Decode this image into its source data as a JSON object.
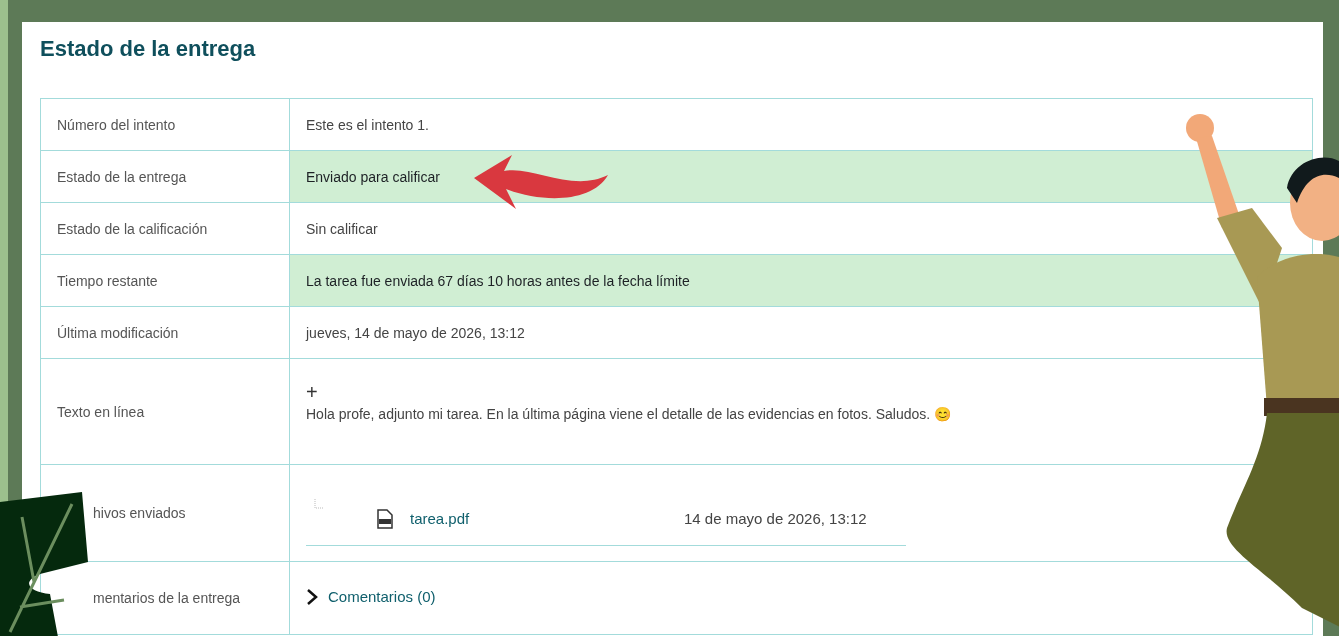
{
  "title": "Estado de la entrega",
  "rows": [
    {
      "label": "Número del intento",
      "kind": "text",
      "value": "Este es el intento 1.",
      "highlighted": false,
      "partly_hidden": false
    },
    {
      "label": "Estado de la entrega",
      "kind": "text",
      "value": "Enviado para calificar",
      "highlighted": true,
      "partly_hidden": false
    },
    {
      "label": "Estado de la calificación",
      "kind": "text",
      "value": "Sin calificar",
      "highlighted": false,
      "partly_hidden": false
    },
    {
      "label": "Tiempo restante",
      "kind": "text",
      "value": "La tarea fue enviada 67 días 10 horas antes de la fecha límite",
      "highlighted": true,
      "partly_hidden": false
    },
    {
      "label": "Última modificación",
      "kind": "text",
      "value": "jueves, 14 de mayo de 2026, 13:12",
      "highlighted": false,
      "partly_hidden": false
    },
    {
      "label": "Texto en línea",
      "kind": "online_text",
      "expand": "+",
      "value": "Hola profe, adjunto mi tarea. En la última página viene el detalle de las evidencias en fotos. Saludos. 😊",
      "highlighted": false,
      "partly_hidden": false
    },
    {
      "label": "hivos enviados",
      "kind": "files",
      "files": [
        {
          "name": "tarea.pdf",
          "date": "14 de mayo de 2026, 13:12"
        }
      ],
      "highlighted": false,
      "partly_hidden": true
    },
    {
      "label": "mentarios de la entrega",
      "kind": "comments",
      "link": "Comentarios (0)",
      "highlighted": false,
      "partly_hidden": true
    }
  ]
}
